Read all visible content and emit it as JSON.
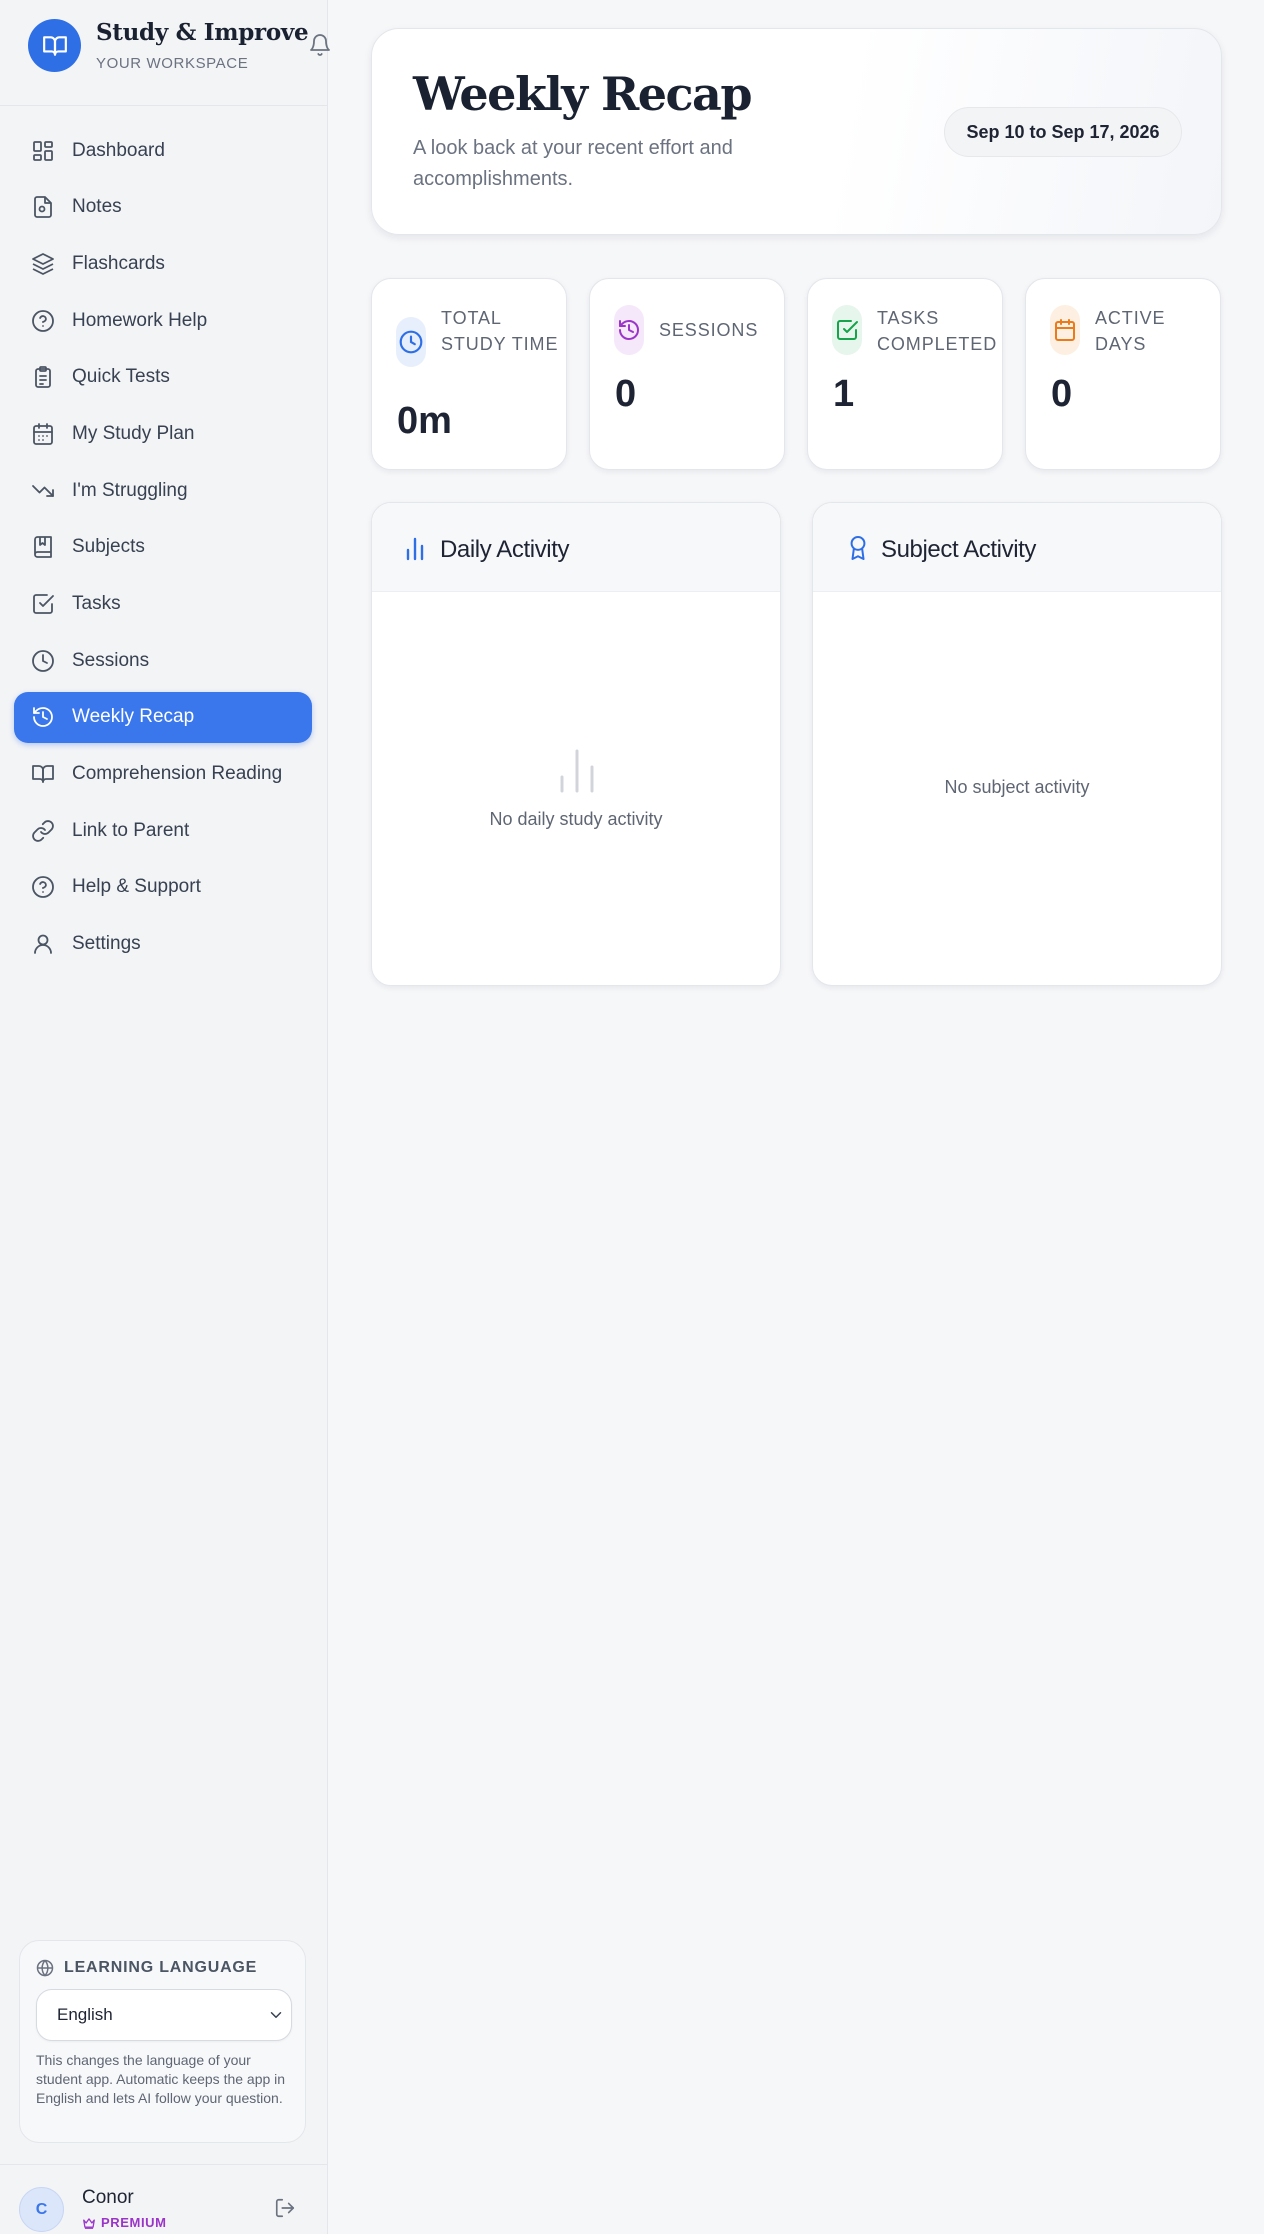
{
  "brand": {
    "title": "Study & Improve",
    "subtitle": "YOUR WORKSPACE",
    "logo_icon": "open-book-icon",
    "notification_icon": "bell-icon"
  },
  "sidebar": {
    "items": [
      {
        "label": "Dashboard",
        "icon": "grid-icon",
        "active": false
      },
      {
        "label": "Notes",
        "icon": "note-icon",
        "active": false
      },
      {
        "label": "Flashcards",
        "icon": "layers-icon",
        "active": false
      },
      {
        "label": "Homework Help",
        "icon": "question-circle-icon",
        "active": false
      },
      {
        "label": "Quick Tests",
        "icon": "clipboard-icon",
        "active": false
      },
      {
        "label": "My Study Plan",
        "icon": "calendar-icon",
        "active": false
      },
      {
        "label": "I'm Struggling",
        "icon": "trending-down-icon",
        "active": false
      },
      {
        "label": "Subjects",
        "icon": "bookmark-book-icon",
        "active": false
      },
      {
        "label": "Tasks",
        "icon": "checkbox-icon",
        "active": false
      },
      {
        "label": "Sessions",
        "icon": "clock-icon",
        "active": false
      },
      {
        "label": "Weekly Recap",
        "icon": "history-icon",
        "active": true
      },
      {
        "label": "Comprehension Reading",
        "icon": "book-open-icon",
        "active": false
      },
      {
        "label": "Link to Parent",
        "icon": "link-icon",
        "active": false
      },
      {
        "label": "Help & Support",
        "icon": "help-circle-icon",
        "active": false
      },
      {
        "label": "Settings",
        "icon": "user-icon",
        "active": false
      }
    ]
  },
  "language": {
    "heading": "LEARNING LANGUAGE",
    "selected": "English",
    "note": "This changes the language of your student app. Automatic keeps the app in English and lets AI follow your question."
  },
  "user": {
    "initial": "C",
    "name": "Conor",
    "plan": "PREMIUM"
  },
  "header": {
    "title": "Weekly Recap",
    "subtitle": "A look back at your recent effort and accomplishments.",
    "date_range": "Sep 10 to Sep 17, 2026"
  },
  "stats": [
    {
      "label": "TOTAL STUDY TIME",
      "value": "0m",
      "icon": "clock-icon",
      "color": "#2f6fe6",
      "bg": "#e8effc"
    },
    {
      "label": "SESSIONS",
      "value": "0",
      "icon": "history-icon",
      "color": "#9b35c9",
      "bg": "#f5e8fb"
    },
    {
      "label": "TASKS COMPLETED",
      "value": "1",
      "icon": "check-square-icon",
      "color": "#16a34a",
      "bg": "#e6f6ec"
    },
    {
      "label": "ACTIVE DAYS",
      "value": "0",
      "icon": "calendar-icon",
      "color": "#ea7a1a",
      "bg": "#fdf0e2"
    }
  ],
  "panels": {
    "daily": {
      "title": "Daily Activity",
      "empty": "No daily study activity",
      "icon": "bar-chart-icon"
    },
    "subject": {
      "title": "Subject Activity",
      "empty": "No subject activity",
      "icon": "award-icon"
    }
  },
  "colors": {
    "accent": "#3a76ec",
    "premium": "#9b35c9"
  }
}
